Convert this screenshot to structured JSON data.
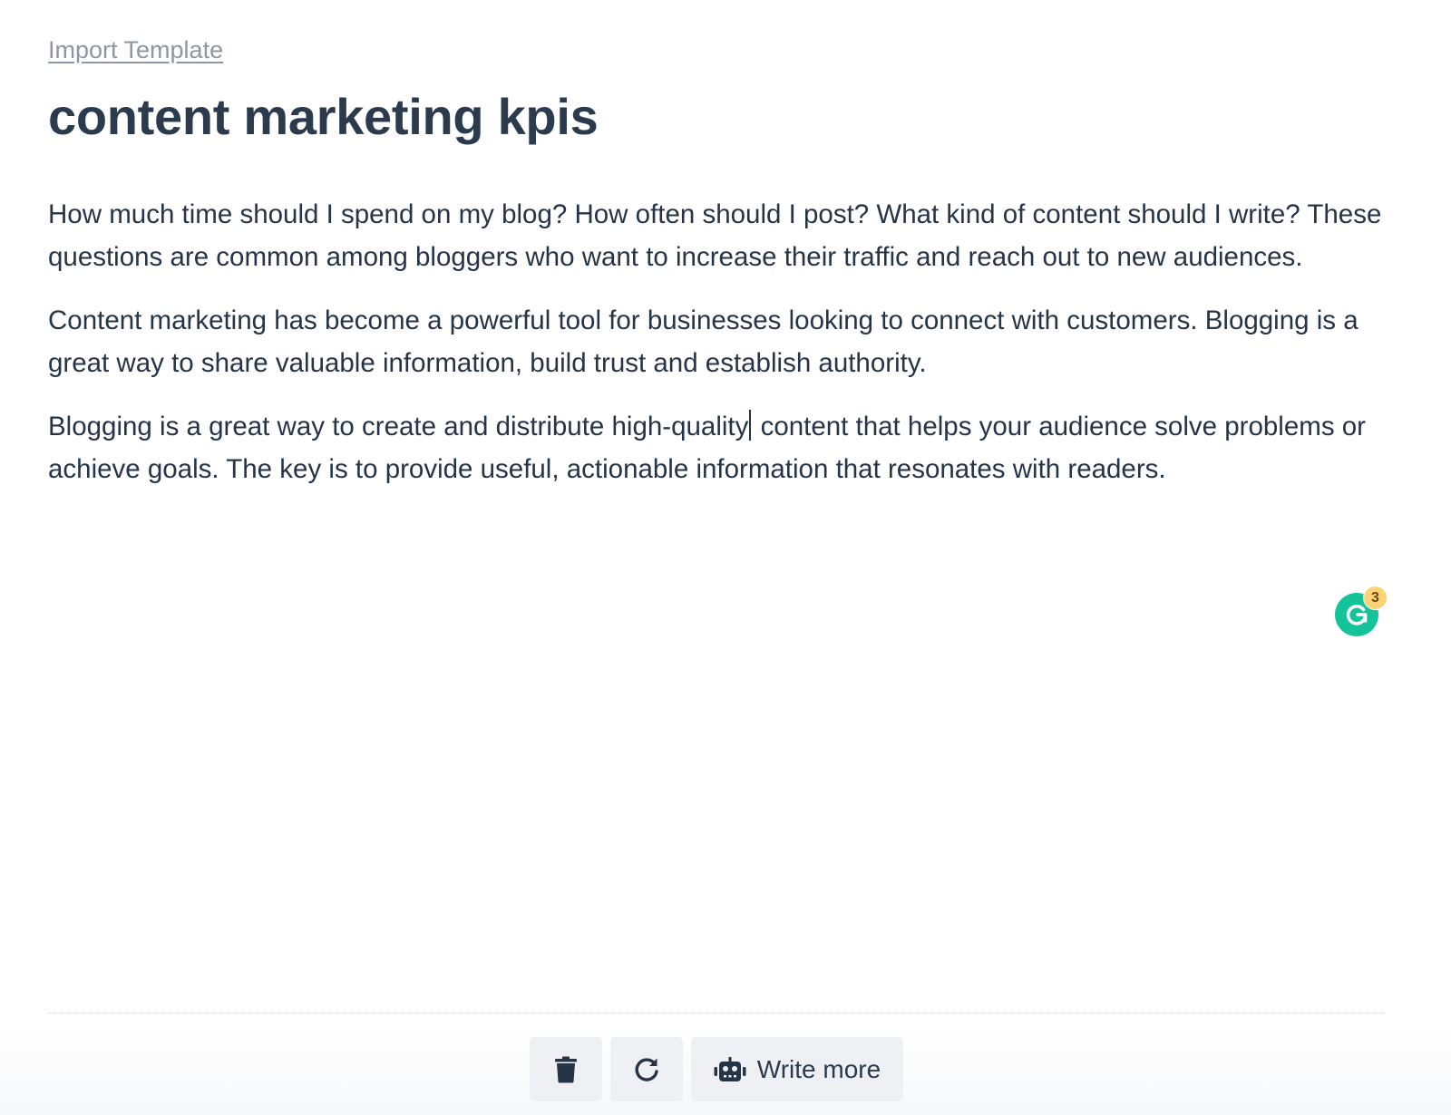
{
  "header": {
    "import_link": "Import Template",
    "title": "content marketing kpis"
  },
  "editor": {
    "paragraphs": [
      "How much time should I spend on my blog? How often should I post? What kind of content should I write? These questions are common among bloggers who want to increase their traffic and reach out to new audiences.",
      "Content marketing has become a powerful tool for businesses looking to connect with customers. Blogging is a great way to share valuable information, build trust and establish authority."
    ],
    "paragraph3_before_caret": "Blogging is a great way to create and distribute high-quality",
    "paragraph3_after_caret": " content that helps your audience solve problems or achieve goals. The key is to provide useful, actionable information that resonates with readers."
  },
  "grammarly": {
    "icon": "grammarly-icon",
    "badge_count": "3",
    "color": "#15c39a",
    "badge_color": "#fcd277"
  },
  "toolbar": {
    "delete_icon": "trash-icon",
    "regenerate_icon": "redo-icon",
    "write_more_icon": "robot-icon",
    "write_more_label": "Write more",
    "button_bg": "#eef0f3"
  }
}
